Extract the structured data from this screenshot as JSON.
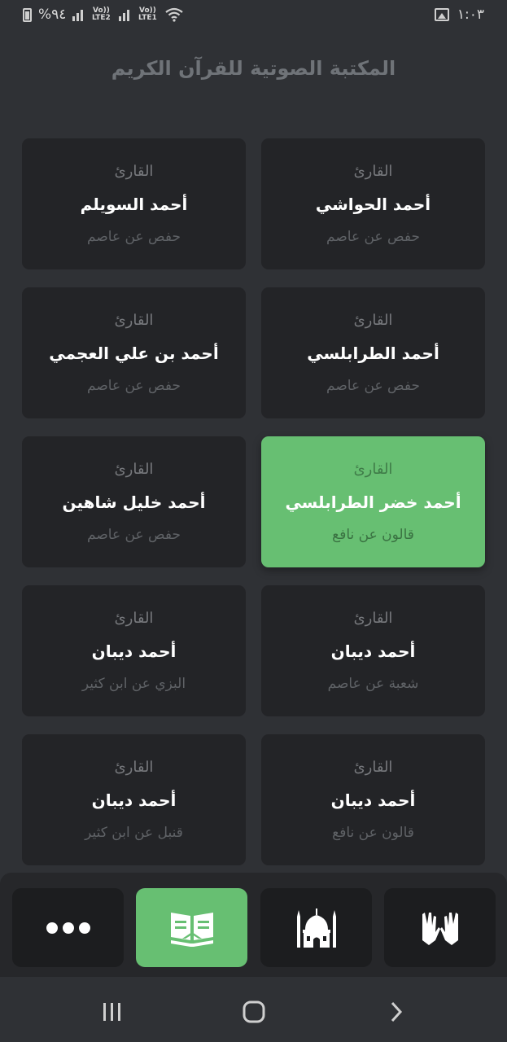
{
  "status_bar": {
    "battery": "%٩٤",
    "sim1": "Vo)) LTE2",
    "sim2": "Vo)) LTE1",
    "time": "١:٠٣"
  },
  "header": {
    "title": "المكتبة الصوتية للقرآن الكريم"
  },
  "reciter_label": "القارئ",
  "cards": [
    {
      "name": "أحمد الحواشي",
      "riwaya": "حفص عن عاصم",
      "selected": false
    },
    {
      "name": "أحمد السويلم",
      "riwaya": "حفص عن عاصم",
      "selected": false
    },
    {
      "name": "أحمد الطرابلسي",
      "riwaya": "حفص عن عاصم",
      "selected": false
    },
    {
      "name": "أحمد بن علي العجمي",
      "riwaya": "حفص عن عاصم",
      "selected": false
    },
    {
      "name": "أحمد خضر الطرابلسي",
      "riwaya": "قالون عن نافع",
      "selected": true
    },
    {
      "name": "أحمد خليل شاهين",
      "riwaya": "حفص عن عاصم",
      "selected": false
    },
    {
      "name": "أحمد ديبان",
      "riwaya": "شعبة عن عاصم",
      "selected": false
    },
    {
      "name": "أحمد ديبان",
      "riwaya": "البزي عن ابن كثير",
      "selected": false
    },
    {
      "name": "أحمد ديبان",
      "riwaya": "قالون عن نافع",
      "selected": false
    },
    {
      "name": "أحمد ديبان",
      "riwaya": "قنبل عن ابن كثير",
      "selected": false
    }
  ],
  "bottom_nav": {
    "items": [
      {
        "icon": "praying-hands-icon",
        "active": false
      },
      {
        "icon": "mosque-icon",
        "active": false
      },
      {
        "icon": "quran-book-icon",
        "active": true
      },
      {
        "icon": "more-dots-icon",
        "active": false
      }
    ]
  },
  "colors": {
    "background": "#2f3135",
    "card": "#232427",
    "accent": "#67bf72"
  }
}
